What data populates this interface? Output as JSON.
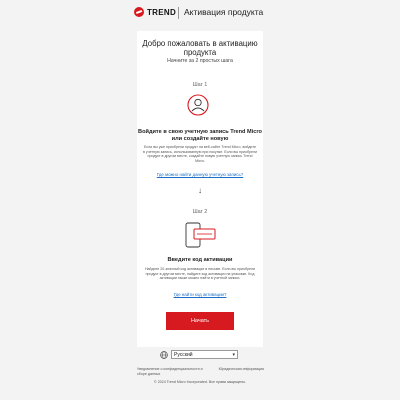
{
  "header": {
    "brand": "TREND",
    "title": "Активация продукта"
  },
  "welcome": {
    "heading": "Добро пожаловать в активацию продукта",
    "subtitle": "Начните за 2 простых шага"
  },
  "step1": {
    "label": "Шаг 1",
    "title": "Войдите в свою учетную запись Trend Micro или создайте новую",
    "description": "Если вы уже приобрели продукт на веб-сайте Trend Micro, войдите в учетную запись, использованную при покупке. Если вы приобрели продукт в другом месте, создайте новую учетную запись Trend Micro.",
    "link": "Где можно найти данную учетную запись?"
  },
  "arrow": "↓",
  "step2": {
    "label": "Шаг 2",
    "title": "Введите код активации",
    "description": "Найдите 20-значный код активации в письме. Если вы приобрели продукт в другом месте, найдите код активации на упаковке. Код активации также можно найти в учетной записи.",
    "link": "Где найти код активации?"
  },
  "next_button": "Начать",
  "language": {
    "selected": "Русский"
  },
  "footer": {
    "left": "Уведомление о конфиденциальности и сборе данных",
    "right": "Юридическая информация",
    "copyright": "© 2024 Trend Micro Incorporated. Все права защищены."
  },
  "colors": {
    "accent": "#d71920",
    "link": "#1a6fc6",
    "page_bg": "#f3f3f3"
  }
}
